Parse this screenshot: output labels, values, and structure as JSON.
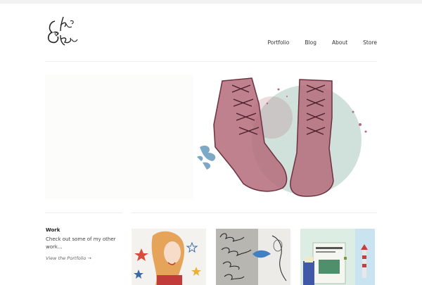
{
  "site": {
    "logo_icon": "miss-kea-script-logo-icon"
  },
  "nav": {
    "items": [
      "Portfolio",
      "Blog",
      "About",
      "Store"
    ]
  },
  "work": {
    "title": "Work",
    "description": "Check out some of my other work...",
    "link": "View the Portfolio →"
  },
  "thumbnails": [
    {
      "icon": "redhead-girl-stars-illustration-icon"
    },
    {
      "icon": "lettering-blue-bird-illustration-icon"
    },
    {
      "icon": "book-lighthouse-illustration-icon"
    }
  ],
  "hero": {
    "icon": "lace-up-boots-illustration-icon"
  }
}
